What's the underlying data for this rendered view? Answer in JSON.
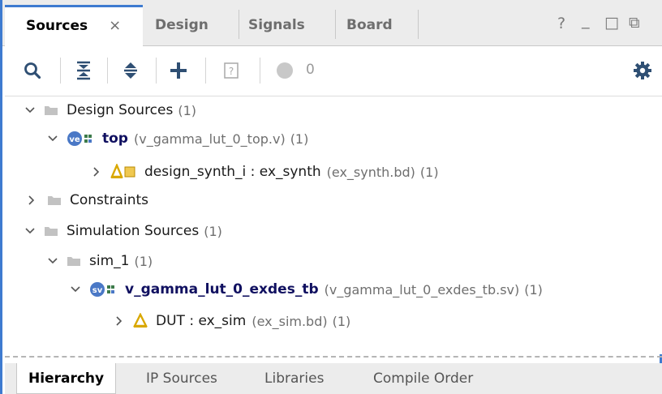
{
  "tabs": {
    "sources": "Sources",
    "close": "×",
    "design": "Design",
    "signals": "Signals",
    "board": "Board"
  },
  "window_controls": {
    "help": "?",
    "minimize": "_",
    "maximize": "□",
    "float": "⧉"
  },
  "toolbar": {
    "error_count": "0"
  },
  "tree": {
    "design_sources": {
      "label": "Design Sources",
      "count": "(1)"
    },
    "top": {
      "label": "top",
      "file": "(v_gamma_lut_0_top.v)",
      "count": "(1)",
      "badge": "ve"
    },
    "design_synth": {
      "label": "design_synth_i : ex_synth",
      "file": "(ex_synth.bd)",
      "count": "(1)"
    },
    "constraints": {
      "label": "Constraints"
    },
    "simulation_sources": {
      "label": "Simulation Sources",
      "count": "(1)"
    },
    "sim_1": {
      "label": "sim_1",
      "count": "(1)"
    },
    "tb": {
      "label": "v_gamma_lut_0_exdes_tb",
      "file": "(v_gamma_lut_0_exdes_tb.sv)",
      "count": "(1)",
      "badge": "sv"
    },
    "dut": {
      "label": "DUT : ex_sim",
      "file": "(ex_sim.bd)",
      "count": "(1)"
    }
  },
  "bottom_tabs": {
    "hierarchy": "Hierarchy",
    "ip_sources": "IP Sources",
    "libraries": "Libraries",
    "compile_order": "Compile Order"
  },
  "colors": {
    "accent": "#3e7bd0",
    "badge": "#4a78c6",
    "bd_icon": "#d9a800"
  }
}
